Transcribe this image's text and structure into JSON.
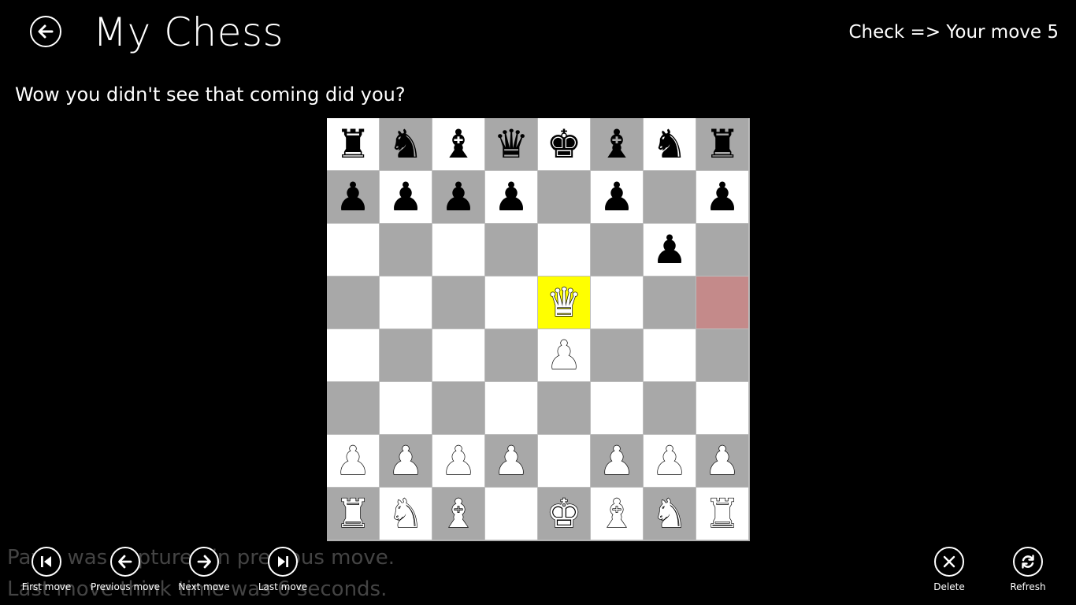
{
  "header": {
    "title": "My Chess",
    "status": "Check => Your move 5",
    "back_icon": "back-arrow-icon"
  },
  "message": "Wow you didn't see that coming did you?",
  "background_text": {
    "line1": "Pawn was captured in previous move.",
    "line2": "Last move think time was 6 seconds."
  },
  "colors": {
    "light_square": "#ffffff",
    "dark_square": "#a8a8a8",
    "selected_square": "#ffff00",
    "target_square": "#c48a8a"
  },
  "board": {
    "rows": [
      [
        "br",
        "bn",
        "bb",
        "bq",
        "bk",
        "bb",
        "bn",
        "br"
      ],
      [
        "bp",
        "bp",
        "bp",
        "bp",
        "",
        "bp",
        "",
        "bp"
      ],
      [
        "",
        "",
        "",
        "",
        "",
        "",
        "bp",
        ""
      ],
      [
        "",
        "",
        "",
        "",
        "wq",
        "",
        "",
        ""
      ],
      [
        "",
        "",
        "",
        "",
        "wp",
        "",
        "",
        ""
      ],
      [
        "",
        "",
        "",
        "",
        "",
        "",
        "",
        ""
      ],
      [
        "wp",
        "wp",
        "wp",
        "wp",
        "",
        "wp",
        "wp",
        "wp"
      ],
      [
        "wr",
        "wn",
        "wb",
        "",
        "wk",
        "wb",
        "wn",
        "wr"
      ]
    ],
    "selected": [
      3,
      4
    ],
    "target": [
      3,
      7
    ]
  },
  "appbar": {
    "left": [
      {
        "label": "First move",
        "icon": "skip-to-start-icon"
      },
      {
        "label": "Previous move",
        "icon": "arrow-left-icon"
      },
      {
        "label": "Next move",
        "icon": "arrow-right-icon"
      },
      {
        "label": "Last move",
        "icon": "skip-to-end-icon"
      }
    ],
    "right": [
      {
        "label": "Delete",
        "icon": "delete-x-icon"
      },
      {
        "label": "Refresh",
        "icon": "refresh-icon"
      }
    ]
  }
}
